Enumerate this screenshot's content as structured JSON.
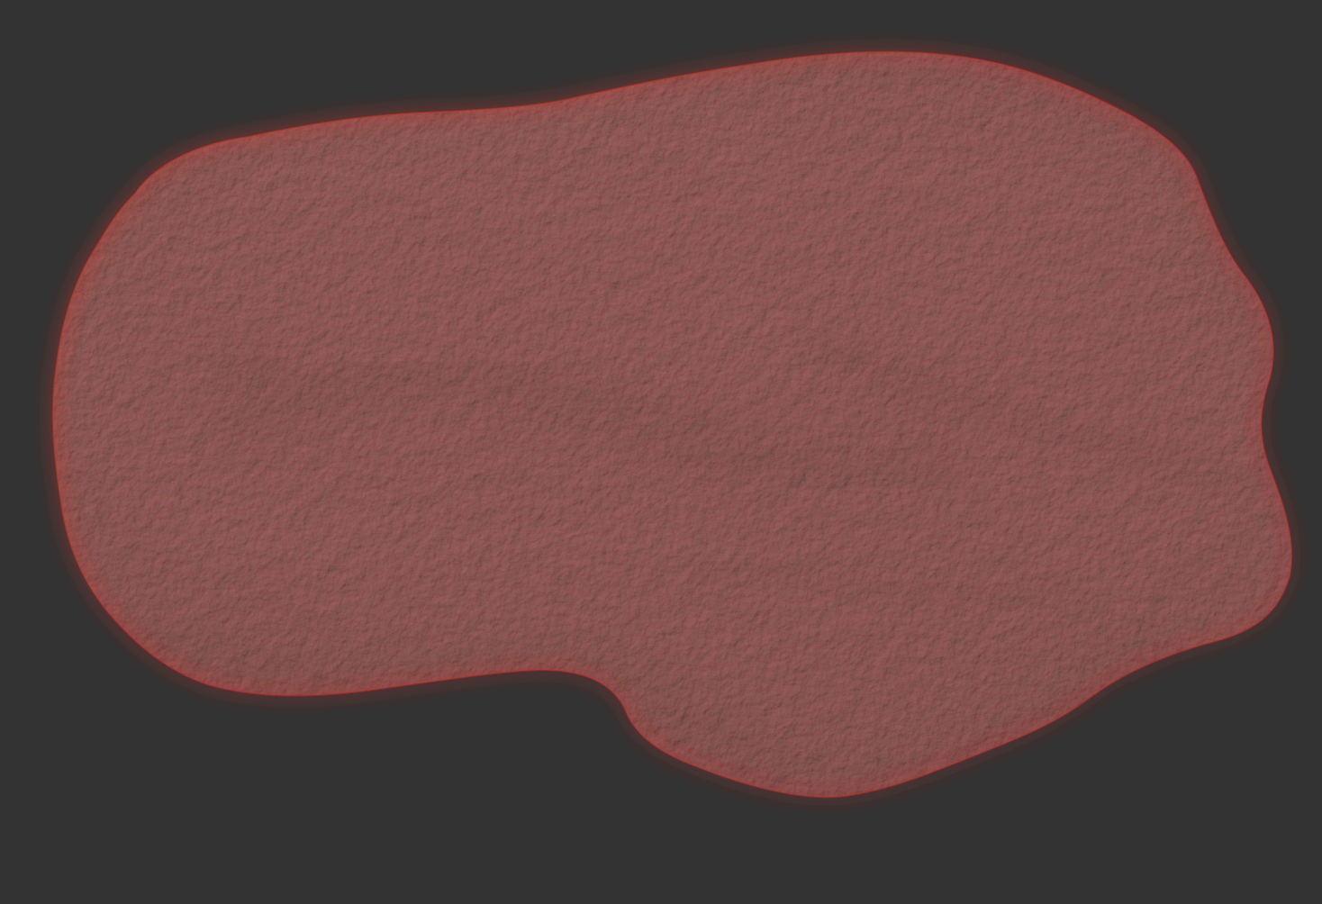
{
  "viewport": {
    "background_color": "#333333"
  },
  "mesh": {
    "subject": "sculpted rock",
    "material": "clay",
    "base_color": "#8a3f3b",
    "shadow_color": "#3a1512",
    "highlight_color": "#b5615a",
    "rim_color": "#c8322c"
  }
}
